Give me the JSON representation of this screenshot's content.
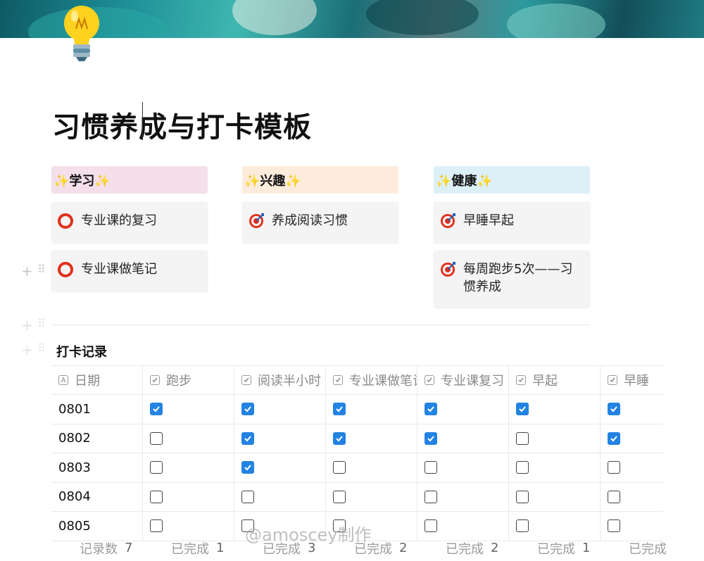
{
  "page": {
    "title": "习惯养成与打卡模板",
    "icon": "lightbulb-icon"
  },
  "columns": [
    {
      "header": "✨学习✨",
      "color": "#f4dfeb",
      "items": [
        {
          "icon": "circle-icon",
          "text": "专业课的复习"
        },
        {
          "icon": "circle-icon",
          "text": "专业课做笔记"
        }
      ]
    },
    {
      "header": "✨兴趣✨",
      "color": "#fdecdc",
      "items": [
        {
          "icon": "target-icon",
          "text": "养成阅读习惯"
        }
      ]
    },
    {
      "header": "✨健康✨",
      "color": "#ddf0f7",
      "items": [
        {
          "icon": "target-icon",
          "text": "早睡早起"
        },
        {
          "icon": "target-icon",
          "text": "每周跑步5次——习惯养成"
        }
      ]
    }
  ],
  "database": {
    "title": "打卡记录",
    "headers": [
      "日期",
      "跑步",
      "阅读半小时",
      "专业课做笔记",
      "专业课复习",
      "早起",
      "早睡"
    ],
    "header_icons": [
      "text-property-icon",
      "checkbox-property-icon",
      "checkbox-property-icon",
      "checkbox-property-icon",
      "checkbox-property-icon",
      "checkbox-property-icon",
      "checkbox-property-icon"
    ],
    "rows": [
      {
        "date": "0801",
        "checks": [
          true,
          true,
          true,
          true,
          true,
          true
        ]
      },
      {
        "date": "0802",
        "checks": [
          false,
          true,
          true,
          true,
          false,
          true
        ]
      },
      {
        "date": "0803",
        "checks": [
          false,
          true,
          false,
          false,
          false,
          false
        ]
      },
      {
        "date": "0804",
        "checks": [
          false,
          false,
          false,
          false,
          false,
          false
        ]
      },
      {
        "date": "0805",
        "checks": [
          false,
          false,
          false,
          false,
          false,
          false
        ]
      }
    ],
    "footer": [
      {
        "label": "记录数",
        "value": "7"
      },
      {
        "label": "已完成",
        "value": "1"
      },
      {
        "label": "已完成",
        "value": "3"
      },
      {
        "label": "已完成",
        "value": "2"
      },
      {
        "label": "已完成",
        "value": "2"
      },
      {
        "label": "已完成",
        "value": "1"
      },
      {
        "label": "已完成",
        "value": ""
      }
    ],
    "check_color": "#2383e2"
  },
  "watermark": "@amoscey制作"
}
